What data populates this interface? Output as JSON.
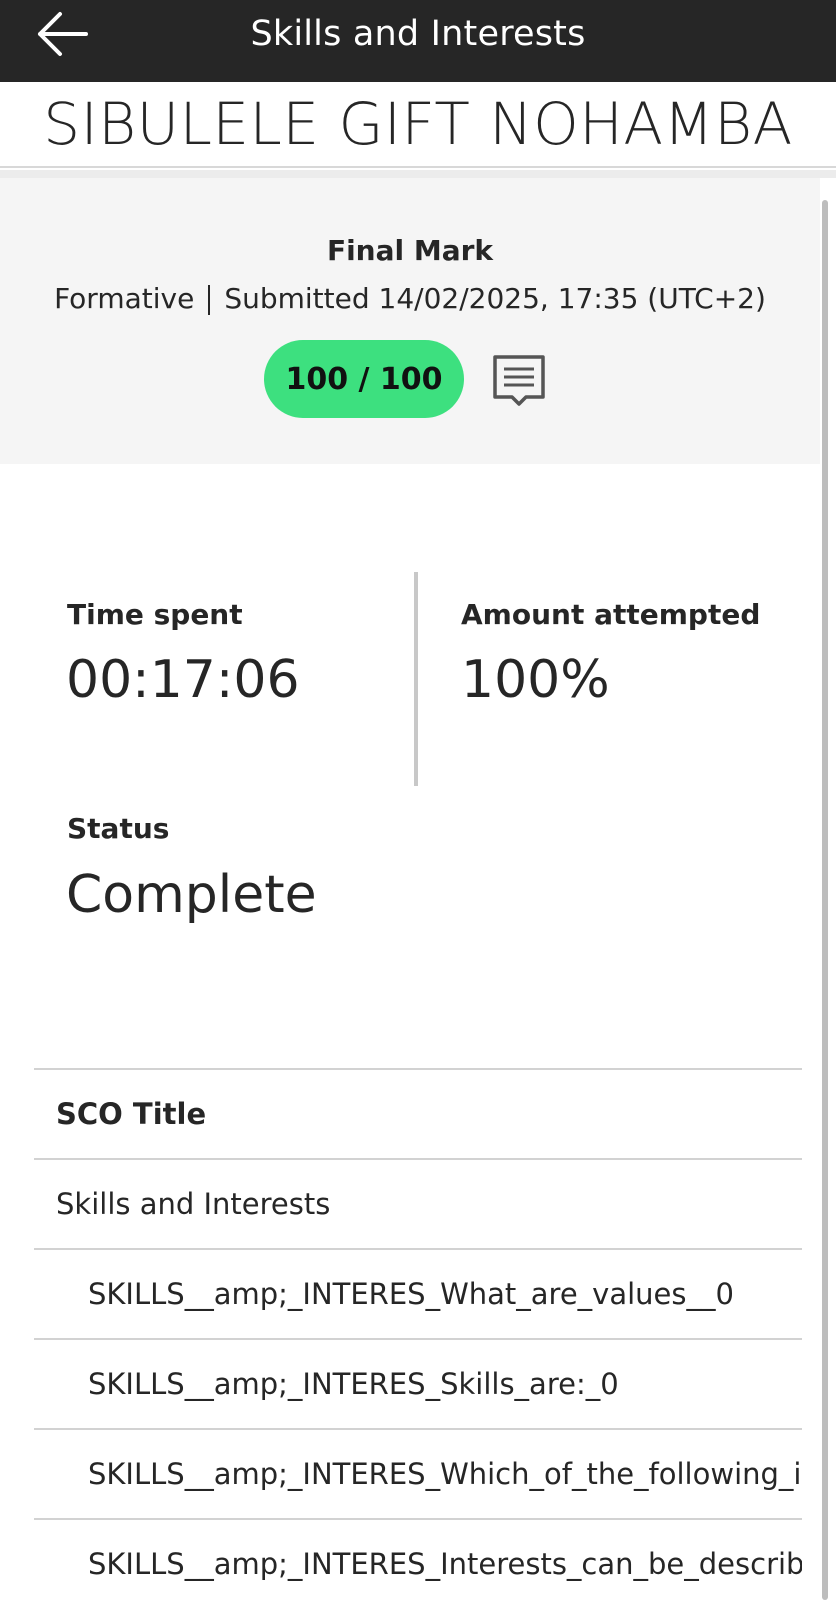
{
  "header": {
    "title": "Skills and Interests",
    "back_icon": "arrow-left-icon"
  },
  "student": {
    "name": "SIBULELE GIFT NOHAMBA"
  },
  "summary": {
    "final_mark_label": "Final Mark",
    "type": "Formative",
    "submitted": "Submitted 14/02/2025, 17:35 (UTC+2)",
    "score": "100 / 100",
    "score_color": "#3de07f",
    "feedback_icon": "comment-icon"
  },
  "stats": {
    "time_spent_label": "Time spent",
    "time_spent_value": "00:17:06",
    "amount_attempted_label": "Amount attempted",
    "amount_attempted_value": "100%",
    "status_label": "Status",
    "status_value": "Complete"
  },
  "sco_table": {
    "header": "SCO Title",
    "parent": "Skills and Interests",
    "children": [
      "SKILLS__amp;_INTERES_What_are_values__0",
      "SKILLS__amp;_INTERES_Skills_are:_0",
      "SKILLS__amp;_INTERES_Which_of_the_following_is_a",
      "SKILLS__amp;_INTERES_Interests_can_be_described"
    ]
  }
}
